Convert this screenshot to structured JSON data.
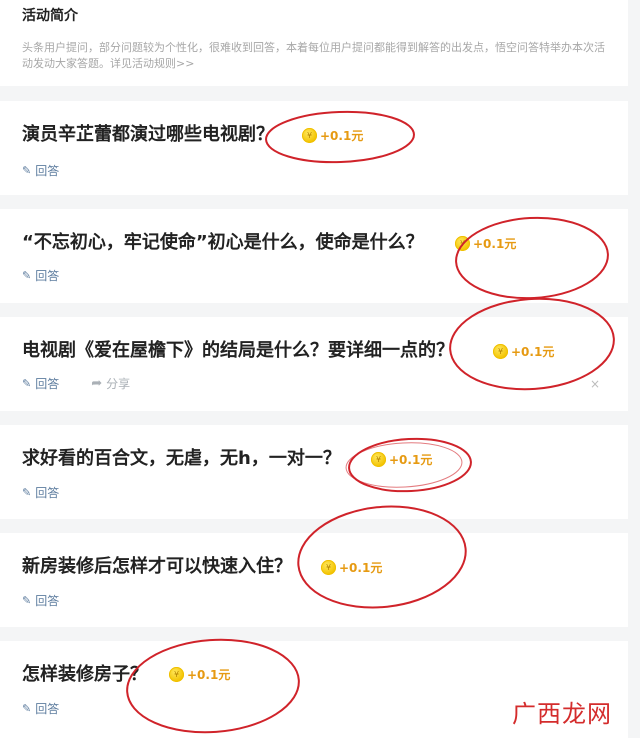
{
  "intro": {
    "title": "活动简介",
    "description": "头条用户提问，部分问题较为个性化，很难收到回答，本着每位用户提问都能得到解答的出发点，悟空问答特举办本次活动发动大家答题。详见活动规则>>"
  },
  "icons": {
    "answer": "pencil-icon",
    "share": "share-arrow-icon",
    "coin": "coin-icon",
    "close": "close-icon"
  },
  "colors": {
    "reward": "#e69a12",
    "action": "#5e7d9f",
    "annotation": "#d0232a"
  },
  "questions": [
    {
      "title": "演员辛芷蕾都演过哪些电视剧？",
      "reward": "+0.1元",
      "answer_label": "回答"
    },
    {
      "title": "“不忘初心，牢记使命”初心是什么，使命是什么？",
      "reward": "+0.1元",
      "answer_label": "回答"
    },
    {
      "title": "电视剧《爱在屋檐下》的结局是什么？要详细一点的？",
      "reward": "+0.1元",
      "answer_label": "回答",
      "share_label": "分享",
      "close_label": "×"
    },
    {
      "title": "求好看的百合文，无虐，无h，一对一？",
      "reward": "+0.1元",
      "answer_label": "回答"
    },
    {
      "title": "新房装修后怎样才可以快速入住？",
      "reward": "+0.1元",
      "answer_label": "回答"
    },
    {
      "title": "怎样装修房子？",
      "reward": "+0.1元",
      "answer_label": "回答"
    }
  ],
  "watermark": "广西龙网"
}
